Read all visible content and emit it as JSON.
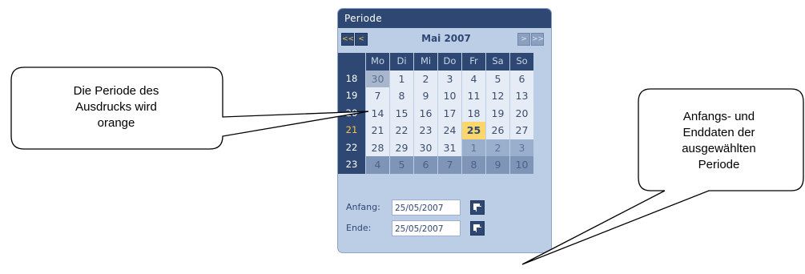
{
  "calendar": {
    "title": "Periode",
    "nav": {
      "prev_year": "<<",
      "prev_month": "<",
      "next_month": ">",
      "next_year": ">>"
    },
    "month_label": "Mai 2007",
    "weekdays": [
      "Mo",
      "Di",
      "Mi",
      "Do",
      "Fr",
      "Sa",
      "So"
    ],
    "weeks": [
      {
        "week": "18",
        "week_highlight": false,
        "days": [
          {
            "d": "30",
            "t": "grey"
          },
          {
            "d": "1",
            "t": "cur"
          },
          {
            "d": "2",
            "t": "cur"
          },
          {
            "d": "3",
            "t": "cur"
          },
          {
            "d": "4",
            "t": "cur"
          },
          {
            "d": "5",
            "t": "cur"
          },
          {
            "d": "6",
            "t": "cur"
          }
        ]
      },
      {
        "week": "19",
        "week_highlight": false,
        "days": [
          {
            "d": "7",
            "t": "cur"
          },
          {
            "d": "8",
            "t": "cur"
          },
          {
            "d": "9",
            "t": "cur"
          },
          {
            "d": "10",
            "t": "cur"
          },
          {
            "d": "11",
            "t": "cur"
          },
          {
            "d": "12",
            "t": "cur"
          },
          {
            "d": "13",
            "t": "cur"
          }
        ]
      },
      {
        "week": "20",
        "week_highlight": false,
        "days": [
          {
            "d": "14",
            "t": "cur"
          },
          {
            "d": "15",
            "t": "cur"
          },
          {
            "d": "16",
            "t": "cur"
          },
          {
            "d": "17",
            "t": "cur"
          },
          {
            "d": "18",
            "t": "cur"
          },
          {
            "d": "19",
            "t": "cur"
          },
          {
            "d": "20",
            "t": "cur"
          }
        ]
      },
      {
        "week": "21",
        "week_highlight": true,
        "days": [
          {
            "d": "21",
            "t": "cur"
          },
          {
            "d": "22",
            "t": "cur"
          },
          {
            "d": "23",
            "t": "cur"
          },
          {
            "d": "24",
            "t": "cur"
          },
          {
            "d": "25",
            "t": "today"
          },
          {
            "d": "26",
            "t": "cur"
          },
          {
            "d": "27",
            "t": "cur"
          }
        ]
      },
      {
        "week": "22",
        "week_highlight": false,
        "days": [
          {
            "d": "28",
            "t": "cur"
          },
          {
            "d": "29",
            "t": "cur"
          },
          {
            "d": "30",
            "t": "cur"
          },
          {
            "d": "31",
            "t": "cur"
          },
          {
            "d": "1",
            "t": "other"
          },
          {
            "d": "2",
            "t": "other"
          },
          {
            "d": "3",
            "t": "other"
          }
        ]
      },
      {
        "week": "23",
        "week_highlight": false,
        "days": [
          {
            "d": "4",
            "t": "other dim"
          },
          {
            "d": "5",
            "t": "other dim"
          },
          {
            "d": "6",
            "t": "other dim"
          },
          {
            "d": "7",
            "t": "other dim"
          },
          {
            "d": "8",
            "t": "other dim"
          },
          {
            "d": "9",
            "t": "other dim"
          },
          {
            "d": "10",
            "t": "other dim"
          }
        ]
      }
    ],
    "start_label": "Anfang:",
    "start_value": "25/05/2007",
    "end_label": "Ende:",
    "end_value": "25/05/2007"
  },
  "callouts": {
    "left": [
      "Die Periode des",
      "Ausdrucks wird",
      "orange"
    ],
    "right": [
      "Anfangs- und",
      "Enddaten der",
      "ausgewählten",
      "Periode"
    ]
  },
  "colors": {
    "header": "#2e4873",
    "panel": "#bccde6",
    "highlight": "#fbd66a",
    "week_highlight": "#f5c542"
  }
}
